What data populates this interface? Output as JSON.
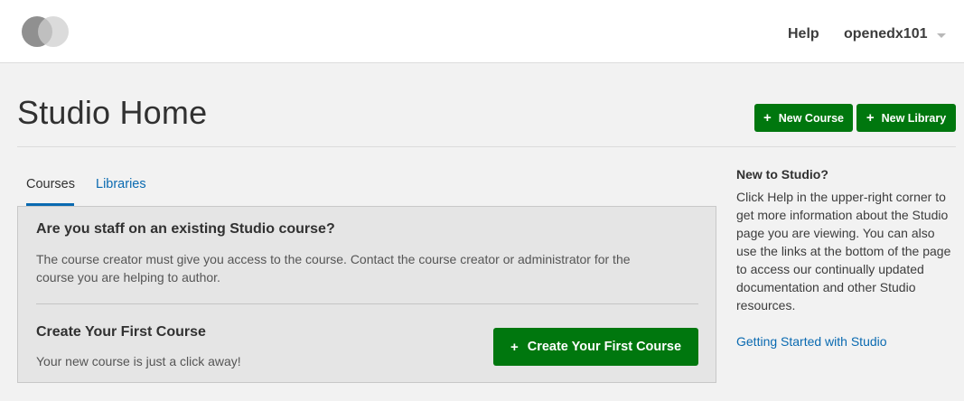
{
  "header": {
    "help_label": "Help",
    "user_label": "openedx101"
  },
  "page": {
    "title": "Studio Home",
    "new_course_label": "New Course",
    "new_library_label": "New Library"
  },
  "tabs": [
    {
      "label": "Courses",
      "active": true
    },
    {
      "label": "Libraries",
      "active": false
    }
  ],
  "notice": {
    "heading": "Are you staff on an existing Studio course?",
    "text": "The course creator must give you access to the course. Contact the course creator or administrator for the course you are helping to author.",
    "create_heading": "Create Your First Course",
    "create_text": "Your new course is just a click away!",
    "create_button_label": "Create Your First Course"
  },
  "sidebar": {
    "heading": "New to Studio?",
    "text": "Click Help in the upper-right corner to get more information about the Studio page you are viewing. You can also use the links at the bottom of the page to access our continually updated documentation and other Studio resources.",
    "link_label": "Getting Started with Studio"
  },
  "colors": {
    "primary_green": "#00770e",
    "link_blue": "#0a6ab1",
    "page_background": "#f2f2f2"
  },
  "icons": {
    "logo": "openedx-logo-icon",
    "plus": "plus-icon",
    "caret": "caret-down-icon"
  }
}
